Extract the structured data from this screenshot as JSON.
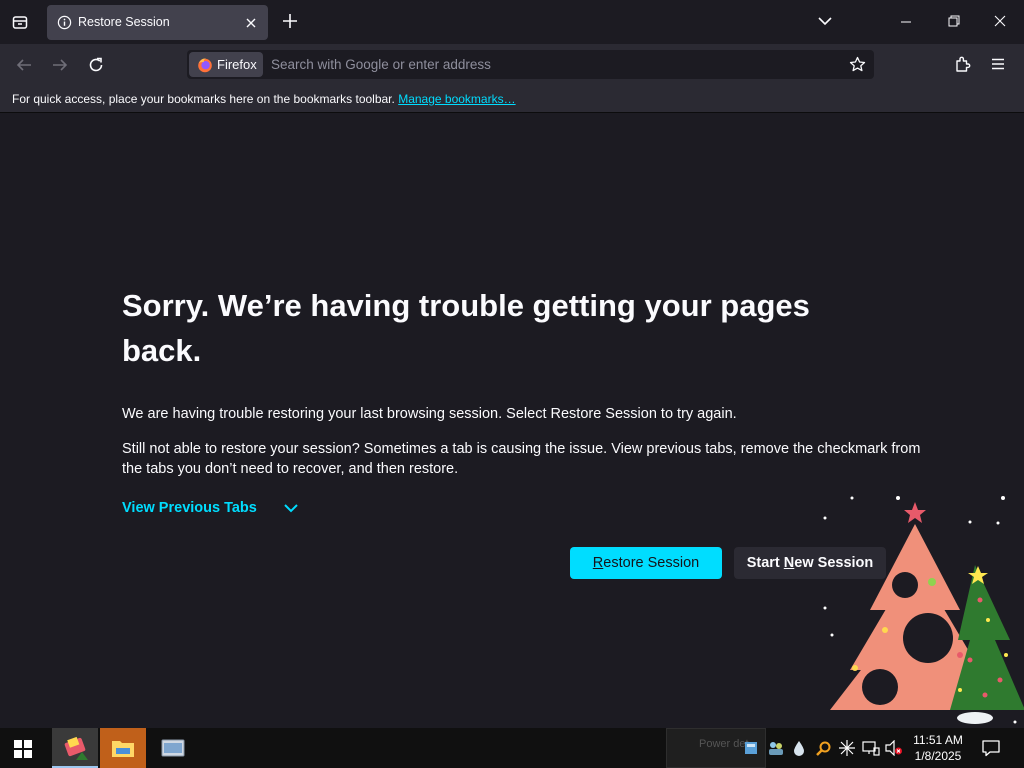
{
  "browser": {
    "tab": {
      "title": "Restore Session"
    },
    "identity_label": "Firefox",
    "address_placeholder": "Search with Google or enter address",
    "bookmarks_message": "For quick access, place your bookmarks here on the bookmarks toolbar.",
    "bookmarks_link": "Manage bookmarks…"
  },
  "page": {
    "heading": "Sorry. We’re having trouble getting your pages back.",
    "paragraph1": "We are having trouble restoring your last browsing session. Select Restore Session to try again.",
    "paragraph2": "Still not able to restore your session? Sometimes a tab is causing the issue. View previous tabs, remove the checkmark from the tabs you don’t need to recover, and then restore.",
    "view_previous_tabs": "View Previous Tabs",
    "restore_button": {
      "access_key": "R",
      "rest": "estore Session"
    },
    "new_session_button": {
      "prefix": "Start ",
      "access_key": "N",
      "rest": "ew Session"
    }
  },
  "taskbar": {
    "power_text": "Power det",
    "time": "11:51 AM",
    "date": "1/8/2025"
  },
  "colors": {
    "accent": "#00ddff",
    "page_bg": "#1c1b22",
    "toolbar_bg": "#2b2a33",
    "tab_bg": "#42414d"
  },
  "icons": [
    "tab-list-icon",
    "info-icon",
    "close-icon",
    "plus-icon",
    "chevron-down-icon",
    "minimize-icon",
    "maximize-icon",
    "back-arrow-icon",
    "forward-arrow-icon",
    "reload-icon",
    "firefox-logo-icon",
    "star-icon",
    "extensions-icon",
    "hamburger-menu-icon",
    "windows-start-icon",
    "notification-icon"
  ]
}
